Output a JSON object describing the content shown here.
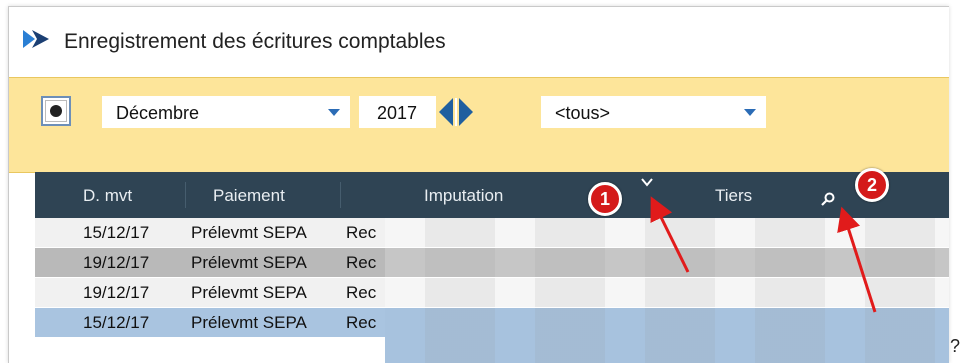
{
  "window": {
    "title": "Enregistrement des écritures comptables"
  },
  "toolbar": {
    "month": "Décembre",
    "year": "2017",
    "filter": "<tous>"
  },
  "grid": {
    "columns": [
      "D. mvt",
      "Paiement",
      "Imputation",
      "Tiers"
    ],
    "rows": [
      {
        "date": "15/12/17",
        "payment": "Prélevmt SEPA",
        "imputation": "Rec"
      },
      {
        "date": "19/12/17",
        "payment": "Prélevmt SEPA",
        "imputation": "Rec"
      },
      {
        "date": "19/12/17",
        "payment": "Prélevmt SEPA",
        "imputation": "Rec"
      },
      {
        "date": "15/12/17",
        "payment": "Prélevmt SEPA",
        "imputation": "Rec"
      }
    ]
  },
  "annotations": {
    "badge1": "1",
    "badge2": "2",
    "trailing_mark": "?"
  },
  "icons": {
    "app": "bird-logo-icon",
    "camera": "camera-icon",
    "dropdown": "chevron-down-icon",
    "sort": "chevron-down-icon",
    "search": "magnifier-icon"
  },
  "colors": {
    "toolbar_bg": "#fde59a",
    "header_bg": "#2f4454",
    "row_white": "#f1f1f1",
    "row_gray": "#b9b9b9",
    "row_selected": "#a9c4e0",
    "accent_blue": "#1f5f9f",
    "badge_red": "#d41a1a"
  }
}
